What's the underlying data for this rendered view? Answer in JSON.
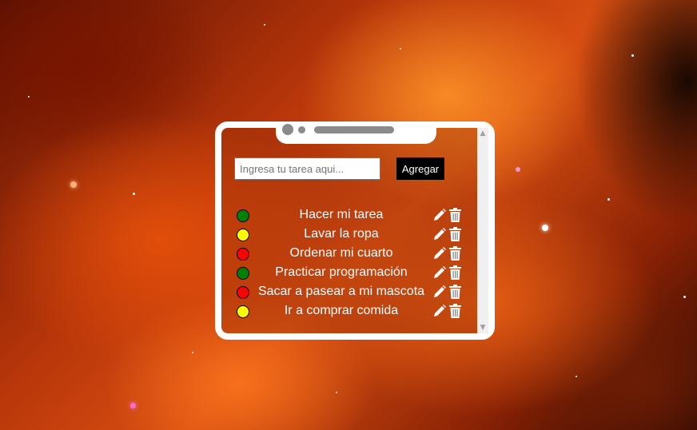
{
  "form": {
    "input_placeholder": "Ingresa tu tarea aqui...",
    "input_value": "",
    "add_label": "Agregar"
  },
  "status_colors": {
    "green": "#008000",
    "yellow": "#ffff00",
    "red": "#ff0000"
  },
  "tasks": [
    {
      "text": "Hacer mi tarea",
      "status": "green",
      "status_color": "#008000",
      "edit_icon": "pencil-icon",
      "delete_icon": "trash-icon"
    },
    {
      "text": "Lavar la ropa",
      "status": "yellow",
      "status_color": "#ffff00",
      "edit_icon": "pencil-icon",
      "delete_icon": "trash-icon"
    },
    {
      "text": "Ordenar mi cuarto",
      "status": "red",
      "status_color": "#ff0000",
      "edit_icon": "pencil-icon",
      "delete_icon": "trash-icon"
    },
    {
      "text": "Practicar programación",
      "status": "green",
      "status_color": "#008000",
      "edit_icon": "pencil-icon",
      "delete_icon": "trash-icon"
    },
    {
      "text": "Sacar a pasear a mi mascota",
      "status": "red",
      "status_color": "#ff0000",
      "edit_icon": "pencil-icon",
      "delete_icon": "trash-icon"
    },
    {
      "text": "Ir a comprar comida",
      "status": "yellow",
      "status_color": "#ffff00",
      "edit_icon": "pencil-icon",
      "delete_icon": "trash-icon"
    }
  ],
  "scrollbar": {
    "up_icon": "chevron-up-icon",
    "down_icon": "chevron-down-icon"
  },
  "colors": {
    "frame": "#ffffff",
    "button_bg": "#000000",
    "text": "#ffffff"
  }
}
